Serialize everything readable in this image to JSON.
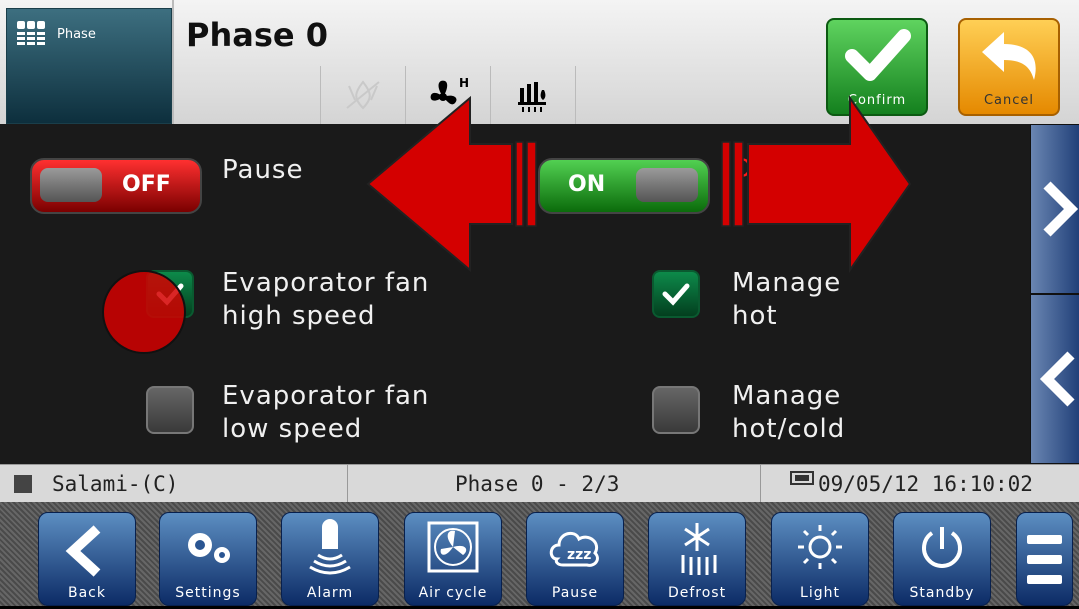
{
  "header": {
    "phase_tile_label": "Phase",
    "title": "Phase 0",
    "icons": [
      "drip-disabled-icon",
      "fan-high-icon",
      "dripping-icon"
    ],
    "confirm_label": "Confirm",
    "cancel_label": "Cancel"
  },
  "main": {
    "pause": {
      "toggle_label": "OFF",
      "label": "Pause",
      "state": "off"
    },
    "dripping": {
      "toggle_label": "ON",
      "label": "Dripping",
      "state": "on"
    },
    "options": [
      {
        "label_line1": "Evaporator fan",
        "label_line2": "high speed",
        "checked": true
      },
      {
        "label_line1": "Manage",
        "label_line2": "hot",
        "checked": true
      },
      {
        "label_line1": "Evaporator fan",
        "label_line2": "low speed",
        "checked": false
      },
      {
        "label_line1": "Manage",
        "label_line2": "hot/cold",
        "checked": false
      }
    ]
  },
  "status": {
    "program": "Salami-(C)",
    "phase": "Phase 0 - 2/3",
    "datetime": "09/05/12 16:10:02"
  },
  "footer": {
    "buttons": [
      {
        "label": "Back",
        "icon": "back-icon"
      },
      {
        "label": "Settings",
        "icon": "gears-icon"
      },
      {
        "label": "Alarm",
        "icon": "bell-icon"
      },
      {
        "label": "Air cycle",
        "icon": "fan-icon"
      },
      {
        "label": "Pause",
        "icon": "sleep-icon"
      },
      {
        "label": "Defrost",
        "icon": "snowflake-icon"
      },
      {
        "label": "Light",
        "icon": "sun-icon"
      },
      {
        "label": "Standby",
        "icon": "power-icon"
      }
    ]
  },
  "colors": {
    "confirm": "#2ca02c",
    "cancel": "#f5a000",
    "off": "#c00000",
    "on": "#1c9a1c",
    "nav": "#1f3f7a",
    "annotation": "#d40000"
  }
}
